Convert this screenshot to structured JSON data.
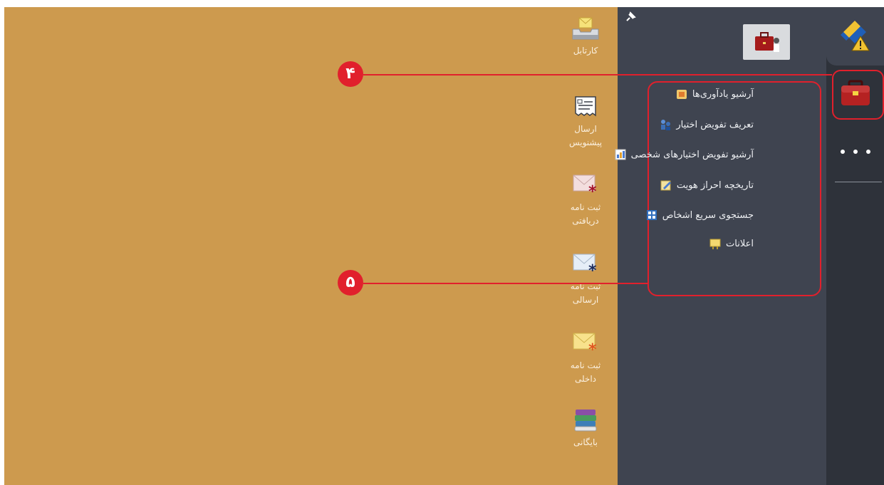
{
  "desktop_icons": [
    {
      "label": "کارتابل",
      "icon": "inbox-tray-icon"
    },
    {
      "label": "ارسال پیشنویس",
      "icon": "draft-document-icon"
    },
    {
      "label": "ثبت نامه دریافتی",
      "icon": "mail-red-asterisk-icon"
    },
    {
      "label": "ثبت نامه ارسالی",
      "icon": "mail-blue-asterisk-icon"
    },
    {
      "label": "ثبت نامه داخلی",
      "icon": "mail-yellow-asterisk-icon"
    },
    {
      "label": "بایگانی",
      "icon": "books-archive-icon"
    }
  ],
  "panel": {
    "pin_icon": "pin-icon",
    "header_icon": "briefcase-user-icon",
    "menu_items": [
      {
        "label": "آرشیو یادآوری‌ها",
        "icon": "reminder-archive-icon"
      },
      {
        "label": "تعریف تفویض اختیار",
        "icon": "delegation-icon"
      },
      {
        "label": "آرشیو تفویض اختیارهای شخصی",
        "icon": "delegation-archive-icon"
      },
      {
        "label": "تاریخچه احراز هویت",
        "icon": "auth-history-icon"
      },
      {
        "label": "جستجوی سریع اشخاص",
        "icon": "people-search-icon"
      },
      {
        "label": "اعلانات",
        "icon": "announcement-icon"
      }
    ]
  },
  "rail": {
    "items": [
      {
        "icon": "warning-app-icon"
      },
      {
        "icon": "briefcase-icon"
      },
      {
        "icon": "more-dots-icon"
      }
    ]
  },
  "annotations": [
    {
      "number": "۴"
    },
    {
      "number": "۵"
    }
  ],
  "colors": {
    "desktop_bg": "#cd9a4e",
    "panel_bg": "#3f4450",
    "rail_bg": "#2e323a",
    "annotation_red": "#e1202c"
  }
}
